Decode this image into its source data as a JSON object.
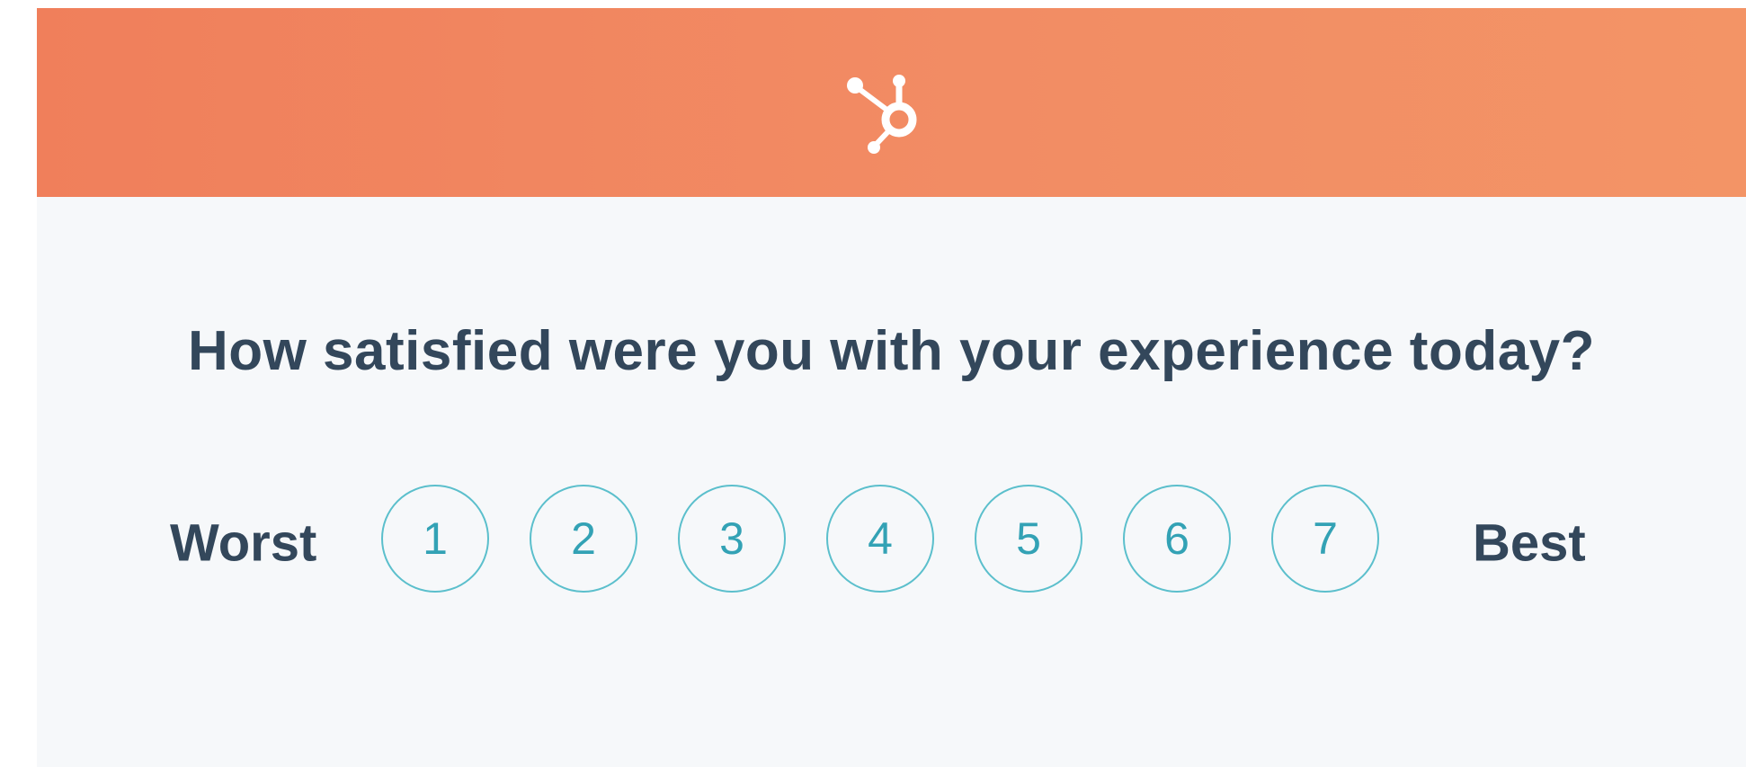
{
  "header": {
    "logo_icon": "hubspot-sprocket-icon",
    "color_start": "#f07f5b",
    "color_end": "#f39466"
  },
  "survey": {
    "question": "How satisfied were you with your experience today?",
    "low_label": "Worst",
    "high_label": "Best",
    "options": [
      "1",
      "2",
      "3",
      "4",
      "5",
      "6",
      "7"
    ]
  },
  "colors": {
    "text": "#33475b",
    "option_border": "#5bbfcc",
    "option_text": "#33a2b5",
    "background": "#f6f8fa"
  }
}
